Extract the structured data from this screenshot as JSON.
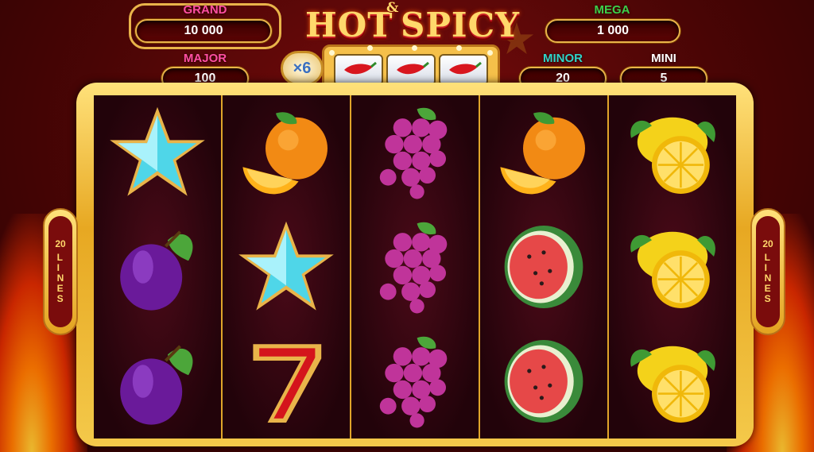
{
  "jackpots": {
    "grand": {
      "label": "GRAND",
      "value": "10 000"
    },
    "major": {
      "label": "MAJOR",
      "value": "100"
    },
    "mega": {
      "label": "MEGA",
      "value": "1 000"
    },
    "minor": {
      "label": "MINOR",
      "value": "20"
    },
    "mini": {
      "label": "MINI",
      "value": "5"
    }
  },
  "logo": {
    "line1": "HOT",
    "amp": "&",
    "line2": "SPICY"
  },
  "multiplier": "×6",
  "mini_reels": [
    "chili-pepper",
    "chili-pepper",
    "chili-pepper"
  ],
  "lines": {
    "count": "20",
    "word": "LINES"
  },
  "reels": [
    [
      "star",
      "plum",
      "plum"
    ],
    [
      "orange",
      "star",
      "seven"
    ],
    [
      "grapes",
      "grapes",
      "grapes"
    ],
    [
      "orange",
      "watermelon",
      "watermelon"
    ],
    [
      "lemon",
      "lemon",
      "lemon"
    ]
  ],
  "colors": {
    "gold": "#e9b44a",
    "jp_label_yellow": "#ffd86b",
    "jp_label_pink": "#ff4fa3",
    "jp_label_green": "#3ccf4a",
    "jp_label_teal": "#2fd3c8",
    "jp_label_white": "#ffffff"
  }
}
